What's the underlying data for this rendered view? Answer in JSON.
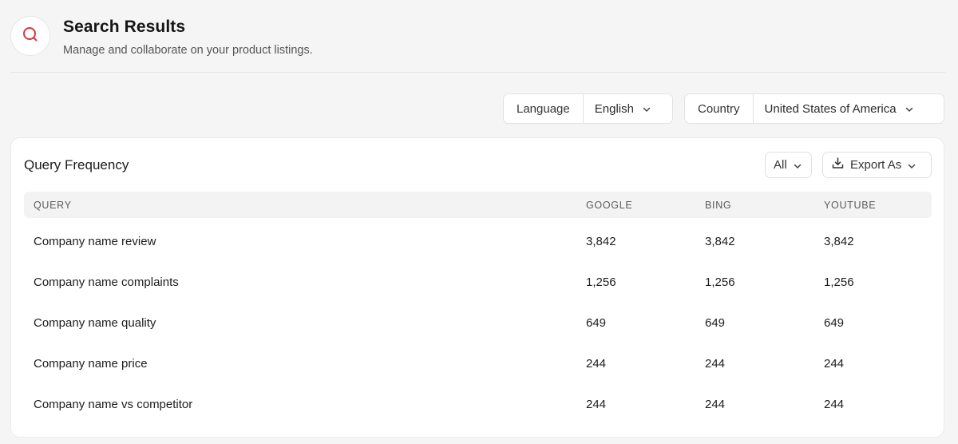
{
  "header": {
    "title": "Search Results",
    "subtitle": "Manage and collaborate on your product listings.",
    "icon": "search-icon",
    "accent_color": "#d9363e"
  },
  "filters": {
    "language": {
      "label": "Language",
      "value": "English"
    },
    "country": {
      "label": "Country",
      "value": "United States of America"
    }
  },
  "card": {
    "title": "Query Frequency",
    "filter_label": "All",
    "export_label": "Export As"
  },
  "table": {
    "columns": [
      "QUERY",
      "GOOGLE",
      "BING",
      "YOUTUBE"
    ],
    "rows": [
      {
        "query": "Company name review",
        "google": "3,842",
        "bing": "3,842",
        "youtube": "3,842"
      },
      {
        "query": "Company name complaints",
        "google": "1,256",
        "bing": "1,256",
        "youtube": "1,256"
      },
      {
        "query": "Company name quality",
        "google": "649",
        "bing": "649",
        "youtube": "649"
      },
      {
        "query": "Company name price",
        "google": "244",
        "bing": "244",
        "youtube": "244"
      },
      {
        "query": "Company name vs competitor",
        "google": "244",
        "bing": "244",
        "youtube": "244"
      }
    ]
  }
}
